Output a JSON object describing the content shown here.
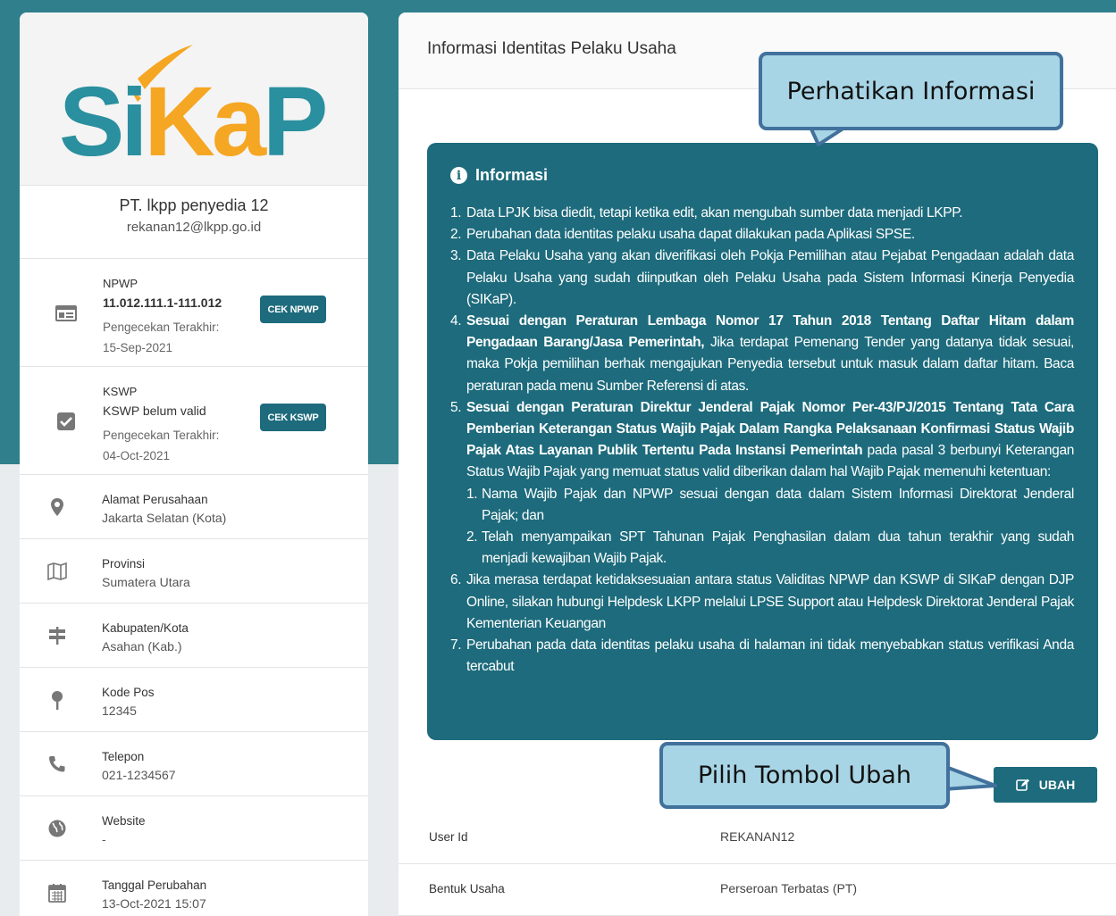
{
  "sidebar": {
    "logo_text": "SiKaP",
    "company_name": "PT. lkpp penyedia 12",
    "company_email": "rekanan12@lkpp.go.id",
    "npwp": {
      "label": "NPWP",
      "value": "11.012.111.1-111.012",
      "check_label": "Pengecekan Terakhir:",
      "check_date": "15-Sep-2021",
      "button": "CEK NPWP",
      "icon": "id-card-icon"
    },
    "kswp": {
      "label": "KSWP",
      "value": "KSWP belum valid",
      "check_label": "Pengecekan Terakhir:",
      "check_date": "04-Oct-2021",
      "button": "CEK KSWP",
      "icon": "checkbox-icon"
    },
    "rows": [
      {
        "label": "Alamat Perusahaan",
        "value": "Jakarta Selatan (Kota)",
        "icon": "map-pin-icon"
      },
      {
        "label": "Provinsi",
        "value": "Sumatera Utara",
        "icon": "map-icon"
      },
      {
        "label": "Kabupaten/Kota",
        "value": "Asahan (Kab.)",
        "icon": "signpost-icon"
      },
      {
        "label": "Kode Pos",
        "value": "12345",
        "icon": "pin-icon"
      },
      {
        "label": "Telepon",
        "value": "021-1234567",
        "icon": "phone-icon"
      },
      {
        "label": "Website",
        "value": "-",
        "icon": "globe-icon"
      },
      {
        "label": "Tanggal Perubahan",
        "value": "13-Oct-2021 15:07",
        "icon": "calendar-icon"
      }
    ]
  },
  "main": {
    "title": "Informasi Identitas Pelaku Usaha",
    "info": {
      "heading": "Informasi",
      "items": [
        {
          "num": "1.",
          "text": "Data LPJK bisa diedit, tetapi ketika edit, akan mengubah sumber data menjadi LKPP."
        },
        {
          "num": "2.",
          "text": "Perubahan data identitas pelaku usaha dapat dilakukan pada Aplikasi SPSE."
        },
        {
          "num": "3.",
          "text": "Data Pelaku Usaha yang akan diverifikasi oleh Pokja Pemilihan atau Pejabat Pengadaan adalah data Pelaku Usaha yang sudah diinputkan oleh Pelaku Usaha pada Sistem Informasi Kinerja Penyedia (SIKaP)."
        },
        {
          "num": "4.",
          "bold": "Sesuai dengan Peraturan Lembaga Nomor 17 Tahun 2018 Tentang Daftar Hitam dalam Pengadaan Barang/Jasa Pemerintah,",
          "text": " Jika terdapat Pemenang Tender yang datanya tidak sesuai, maka Pokja pemilihan berhak mengajukan Penyedia tersebut untuk masuk dalam daftar hitam. Baca peraturan pada menu Sumber Referensi di atas."
        },
        {
          "num": "5.",
          "bold": "Sesuai dengan Peraturan Direktur Jenderal Pajak Nomor Per-43/PJ/2015 Tentang Tata Cara Pemberian Keterangan Status Wajib Pajak Dalam Rangka Pelaksanaan Konfirmasi Status Wajib Pajak Atas Layanan Publik Tertentu Pada Instansi Pemerintah",
          "text": " pada pasal 3 berbunyi Keterangan Status Wajib Pajak yang memuat status valid diberikan dalam hal Wajib Pajak memenuhi ketentuan:",
          "sub": [
            {
              "num": "1.",
              "text": "Nama Wajib Pajak dan NPWP sesuai dengan data dalam Sistem Informasi Direktorat Jenderal Pajak; dan"
            },
            {
              "num": "2.",
              "text": "Telah menyampaikan SPT Tahunan Pajak Penghasilan dalam dua tahun terakhir yang sudah menjadi kewajiban Wajib Pajak."
            }
          ]
        },
        {
          "num": "6.",
          "text": "Jika merasa terdapat ketidaksesuaian antara status Validitas NPWP dan KSWP di SIKaP dengan DJP Online, silakan hubungi Helpdesk LKPP melalui LPSE Support atau Helpdesk Direktorat Jenderal Pajak Kementerian Keuangan"
        },
        {
          "num": "7.",
          "text": "Perubahan pada data identitas pelaku usaha di halaman ini tidak menyebabkan status verifikasi Anda tercabut"
        }
      ]
    },
    "ubah_button": "UBAH",
    "details": [
      {
        "key": "User Id",
        "value": "REKANAN12"
      },
      {
        "key": "Bentuk Usaha",
        "value": "Perseroan Terbatas (PT)"
      }
    ]
  },
  "callouts": {
    "top": "Perhatikan Informasi",
    "bottom": "Pilih Tombol Ubah"
  },
  "colors": {
    "primary": "#1d6b7c",
    "logo_teal": "#2a8f9e",
    "logo_orange": "#f5a623",
    "callout_fill": "#a8d5e5",
    "callout_border": "#41719c"
  }
}
